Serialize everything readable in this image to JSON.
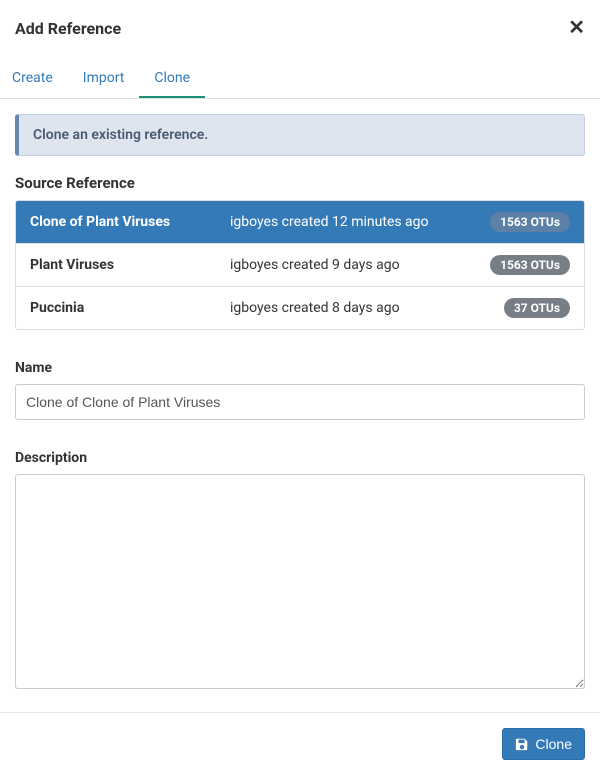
{
  "modal": {
    "title": "Add Reference"
  },
  "tabs": {
    "create": "Create",
    "import": "Import",
    "clone": "Clone",
    "active": "clone"
  },
  "alert": {
    "text": "Clone an existing reference."
  },
  "source": {
    "heading": "Source Reference",
    "items": [
      {
        "name": "Clone of Plant Viruses",
        "created": "igboyes created 12 minutes ago",
        "badge": "1563 OTUs",
        "selected": true
      },
      {
        "name": "Plant Viruses",
        "created": "igboyes created 9 days ago",
        "badge": "1563 OTUs",
        "selected": false
      },
      {
        "name": "Puccinia",
        "created": "igboyes created 8 days ago",
        "badge": "37 OTUs",
        "selected": false
      }
    ]
  },
  "name_field": {
    "label": "Name",
    "value": "Clone of Clone of Plant Viruses"
  },
  "description_field": {
    "label": "Description",
    "value": ""
  },
  "footer": {
    "clone_label": "Clone"
  }
}
